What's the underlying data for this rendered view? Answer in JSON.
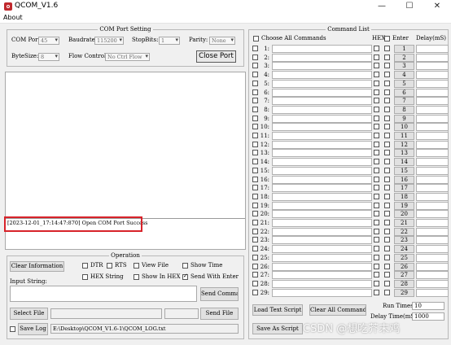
{
  "window": {
    "title": "QCOM_V1.6",
    "minimize": "—",
    "maximize": "☐",
    "close": "✕"
  },
  "menu": {
    "about": "About"
  },
  "com_port_setting": {
    "title": "COM Port Setting",
    "com_port_label": "COM Port:",
    "com_port_value": "45",
    "baudrate_label": "Baudrate:",
    "baudrate_value": "115200",
    "stopbits_label": "StopBits:",
    "stopbits_value": "1",
    "parity_label": "Parity:",
    "parity_value": "None",
    "bytesize_label": "ByteSize:",
    "bytesize_value": "8",
    "flow_control_label": "Flow Control:",
    "flow_control_value": "No Ctrl Flow",
    "close_port_label": "Close Port"
  },
  "log": {
    "line": "[2023-12-01_17:14:47:870] Open COM Port Success"
  },
  "operation": {
    "title": "Operation",
    "clear_info_label": "Clear Information",
    "dtr_label": "DTR",
    "rts_label": "RTS",
    "view_file_label": "View File",
    "show_time_label": "Show Time",
    "hex_string_label": "HEX String",
    "show_in_hex_label": "Show In HEX",
    "send_with_enter_label": "Send With Enter",
    "send_with_enter_checked": true,
    "input_string_label": "Input String:",
    "send_command_label": "Send Command",
    "select_file_label": "Select File",
    "send_file_label": "Send File",
    "save_log_label": "Save Log",
    "log_path": "E:\\Desktop\\QCOM_V1.6-1\\QCOM_LOG.txt"
  },
  "command_list": {
    "title": "Command List",
    "choose_all_label": "Choose All Commands",
    "hex_header": "HEX",
    "enter_header": "Enter",
    "delay_header": "Delay(mS)",
    "rows": [
      {
        "num": "1:",
        "btn": "1"
      },
      {
        "num": "2:",
        "btn": "2"
      },
      {
        "num": "3:",
        "btn": "3"
      },
      {
        "num": "4:",
        "btn": "4"
      },
      {
        "num": "5:",
        "btn": "5"
      },
      {
        "num": "6:",
        "btn": "6"
      },
      {
        "num": "7:",
        "btn": "7"
      },
      {
        "num": "8:",
        "btn": "8"
      },
      {
        "num": "9:",
        "btn": "9"
      },
      {
        "num": "10:",
        "btn": "10"
      },
      {
        "num": "11:",
        "btn": "11"
      },
      {
        "num": "12:",
        "btn": "12"
      },
      {
        "num": "13:",
        "btn": "13"
      },
      {
        "num": "14:",
        "btn": "14"
      },
      {
        "num": "15:",
        "btn": "15"
      },
      {
        "num": "16:",
        "btn": "16"
      },
      {
        "num": "17:",
        "btn": "17"
      },
      {
        "num": "18:",
        "btn": "18"
      },
      {
        "num": "19:",
        "btn": "19"
      },
      {
        "num": "20:",
        "btn": "20"
      },
      {
        "num": "21:",
        "btn": "21"
      },
      {
        "num": "22:",
        "btn": "22"
      },
      {
        "num": "23:",
        "btn": "23"
      },
      {
        "num": "24:",
        "btn": "24"
      },
      {
        "num": "25:",
        "btn": "25"
      },
      {
        "num": "26:",
        "btn": "26"
      },
      {
        "num": "27:",
        "btn": "27"
      },
      {
        "num": "28:",
        "btn": "28"
      },
      {
        "num": "29:",
        "btn": "29"
      }
    ],
    "load_script_label": "Load Text Script",
    "clear_all_label": "Clear All Commands",
    "save_script_label": "Save As Script",
    "run_times_label": "Run Times:",
    "run_times_value": "10",
    "delay_time_label": "Delay Time(mS):",
    "delay_time_value": "1000"
  },
  "watermark": "CSDN @想吃芥末鸡"
}
